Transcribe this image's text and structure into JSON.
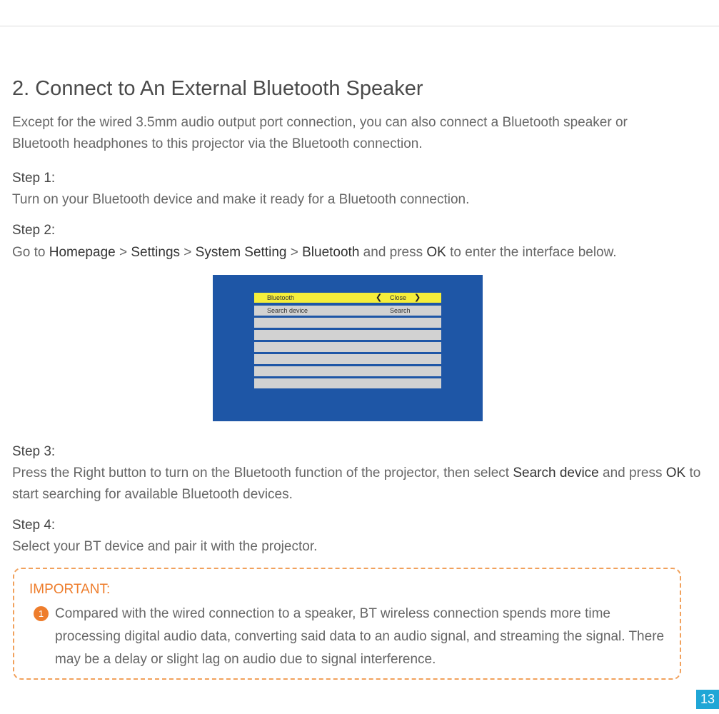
{
  "section": {
    "title": "2. Connect to An External Bluetooth Speaker",
    "intro": "Except for the wired 3.5mm audio output port connection, you can also connect a Bluetooth speaker or Bluetooth headphones to this projector via the Bluetooth connection."
  },
  "steps": [
    {
      "label": "Step 1:",
      "text": "Turn on your Bluetooth device and make it ready for a Bluetooth connection."
    },
    {
      "label": "Step 2:",
      "parts": [
        "Go to ",
        "Homepage",
        " > ",
        "Settings",
        " > ",
        "System Setting",
        " > ",
        "Bluetooth",
        " and press ",
        "OK",
        " to enter the interface below."
      ]
    },
    {
      "label": "Step 3:",
      "parts": [
        "Press the Right button to turn on the Bluetooth function of the projector, then select ",
        "Search device",
        " and press ",
        "OK",
        " to start searching for available Bluetooth devices."
      ]
    },
    {
      "label": "Step 4:",
      "text": "Select your BT device and pair it with the projector."
    }
  ],
  "bt_ui": {
    "header_label": "Bluetooth",
    "header_value": "Close",
    "chevron_left": "❮",
    "chevron_right": "❯",
    "search_label": "Search device",
    "search_value": "Search",
    "colors": {
      "panel": "#1e56a6",
      "header_row": "#f5ee3a",
      "row": "#d2d2d2"
    }
  },
  "important": {
    "title": "IMPORTANT:",
    "badge": "1",
    "text": "Compared with the wired connection to a speaker, BT wireless connection spends more time processing digital audio data, converting said data to an audio signal, and streaming the signal. There may be a delay or slight lag on audio due to signal interference."
  },
  "page": {
    "number": "13"
  }
}
